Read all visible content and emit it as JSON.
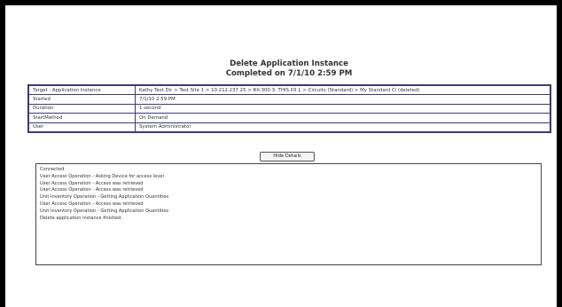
{
  "header": {
    "title": "Delete Application Instance",
    "subtitle": "Completed on 7/1/10 2:59 PM"
  },
  "details": [
    {
      "label": "Target : Application Instance",
      "value": "Kathy Test Dir > Test Site 1 > 10.212.237.25 > RX-300 3: THIS.03.1 > Circuits (Standard) > My Standard Ci (deleted)"
    },
    {
      "label": "Started",
      "value": "7/1/10 2:59 PM"
    },
    {
      "label": "Duration",
      "value": "1 second"
    },
    {
      "label": "StartMethod",
      "value": "On Demand"
    },
    {
      "label": "User",
      "value": "System Administrator"
    }
  ],
  "hide_details_button": "Hide Details",
  "log_lines": [
    "Connected",
    "User Access Operation - Asking Device for access level",
    "User Access Operation - Access was retrieved",
    "User Access Operation - Access was retrieved",
    "Unit Inventory Operation - Getting Application Quantities",
    "User Access Operation - Access was retrieved",
    "Unit Inventory Operation - Getting Application Quantities",
    "Delete application instance finished."
  ]
}
